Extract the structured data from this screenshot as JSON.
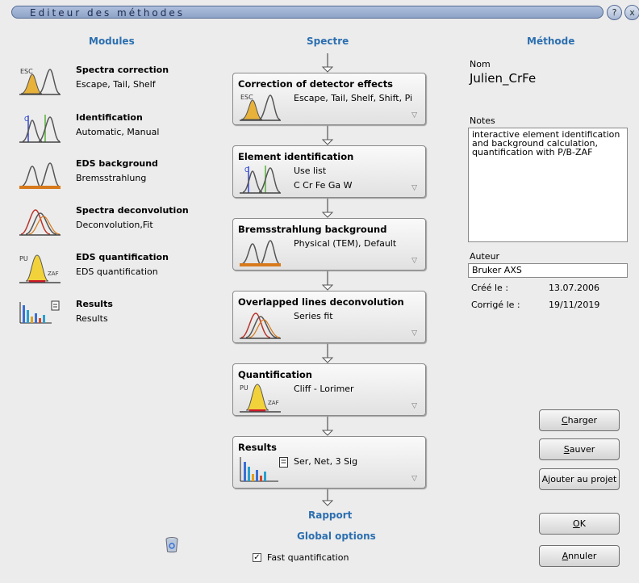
{
  "window": {
    "title": "Editeur des méthodes",
    "help_label": "?",
    "close_label": "x"
  },
  "headers": {
    "modules": "Modules",
    "spectre": "Spectre",
    "methode": "Méthode"
  },
  "modules": [
    {
      "title": "Spectra correction",
      "sub": "Escape, Tail, Shelf"
    },
    {
      "title": "Identification",
      "sub": "Automatic, Manual"
    },
    {
      "title": "EDS background",
      "sub": "Bremsstrahlung"
    },
    {
      "title": "Spectra deconvolution",
      "sub": "Deconvolution,Fit"
    },
    {
      "title": "EDS quantification",
      "sub": "EDS quantification"
    },
    {
      "title": "Results",
      "sub": "Results"
    }
  ],
  "steps": [
    {
      "title": "Correction of detector effects",
      "line1": "Escape, Tail, Shelf, Shift, Pi",
      "line2": ""
    },
    {
      "title": "Element identification",
      "line1": "Use list",
      "line2": "C Cr Fe Ga W"
    },
    {
      "title": "Bremsstrahlung background",
      "line1": "Physical (TEM), Default",
      "line2": ""
    },
    {
      "title": "Overlapped lines deconvolution",
      "line1": "Series fit",
      "line2": ""
    },
    {
      "title": "Quantification",
      "line1": "Cliff - Lorimer",
      "line2": ""
    },
    {
      "title": "Results",
      "line1": "Ser, Net, 3 Sig",
      "line2": ""
    }
  ],
  "icon_labels": {
    "esc": "ESC",
    "c": "C",
    "pu": "PU",
    "zaf": "ZAF"
  },
  "links": {
    "rapport": "Rapport",
    "global": "Global options"
  },
  "fast_quant": {
    "label": "Fast quantification",
    "checked": true
  },
  "method": {
    "nom_label": "Nom",
    "nom_value": "Julien_CrFe",
    "notes_label": "Notes",
    "notes_value": "interactive element identification and background calculation, quantification with P/B-ZAF",
    "auteur_label": "Auteur",
    "auteur_value": "Bruker AXS",
    "cree_label": "Créé le :",
    "cree_value": "13.07.2006",
    "corrige_label": "Corrigé le :",
    "corrige_value": "19/11/2019"
  },
  "buttons": {
    "charger": "harger",
    "charger_key": "C",
    "sauver": "auver",
    "sauver_key": "S",
    "ajouter": "Ajouter au projet",
    "ok": "K",
    "ok_key": "O",
    "annuler": "nnuler",
    "annuler_key": "A"
  },
  "colors": {
    "accent": "#2c6fb0",
    "title_bar": "#9fb2d3"
  }
}
